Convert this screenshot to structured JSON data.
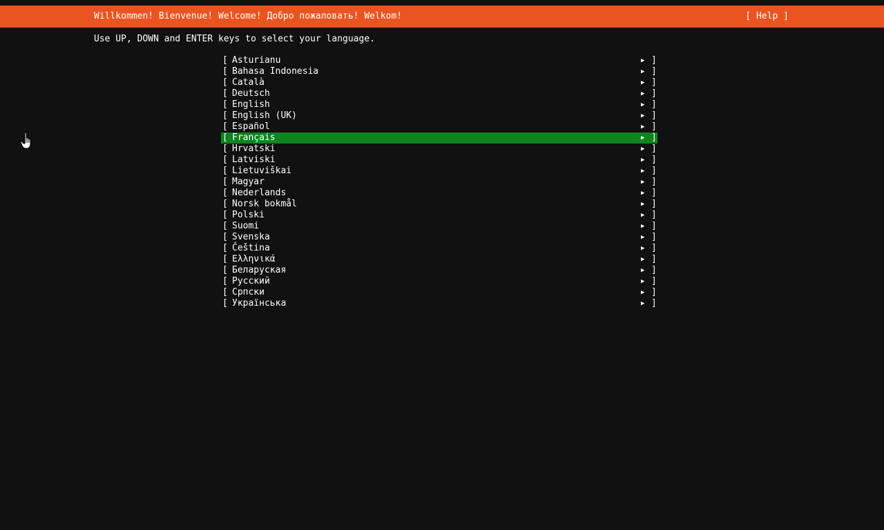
{
  "header": {
    "title": "Willkommen! Bienvenue! Welcome! Добро пожаловать! Welkom!",
    "help_label": "[ Help ]",
    "background_color": "#e95420"
  },
  "instructions": "Use UP, DOWN and ENTER keys to select your language.",
  "language_list": {
    "bracket_open": "[",
    "bracket_close": "]",
    "arrow": "▶",
    "selected_color": "#0e8420",
    "items": [
      {
        "label": "Asturianu"
      },
      {
        "label": "Bahasa Indonesia"
      },
      {
        "label": "Català"
      },
      {
        "label": "Deutsch"
      },
      {
        "label": "English"
      },
      {
        "label": "English (UK)"
      },
      {
        "label": "Español"
      },
      {
        "label": "Français",
        "selected": true
      },
      {
        "label": "Hrvatski"
      },
      {
        "label": "Latviski"
      },
      {
        "label": "Lietuviškai"
      },
      {
        "label": "Magyar"
      },
      {
        "label": "Nederlands"
      },
      {
        "label": "Norsk bokmål"
      },
      {
        "label": "Polski"
      },
      {
        "label": "Suomi"
      },
      {
        "label": "Svenska"
      },
      {
        "label": "Čeština"
      },
      {
        "label": "Ελληνικά"
      },
      {
        "label": "Беларуская"
      },
      {
        "label": "Русский"
      },
      {
        "label": "Српски"
      },
      {
        "label": "Українська"
      }
    ]
  },
  "cursor_icon": "hand-pointer-icon"
}
